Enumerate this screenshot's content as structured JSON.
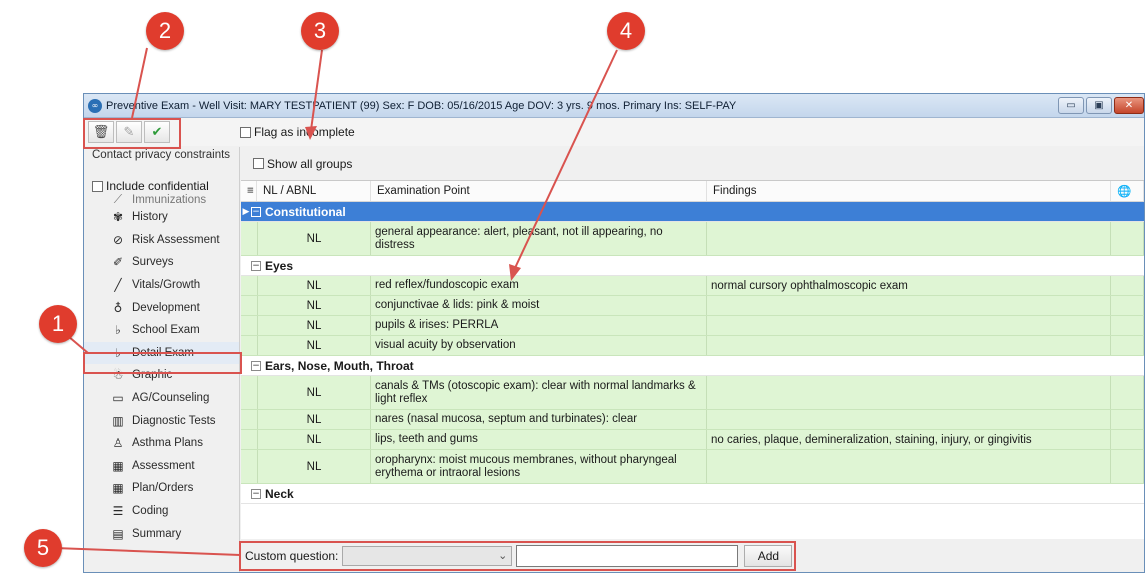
{
  "window": {
    "title": "Preventive Exam - Well Visit:  MARY TESTPATIENT (99)  Sex: F  DOB: 05/16/2015  Age DOV: 3 yrs. 9 mos.  Primary Ins: SELF-PAY",
    "app_icon": "∞",
    "controls": {
      "minimize": "▭",
      "maximize": "▣",
      "close": "✕"
    }
  },
  "toolbar": {
    "delete_icon": "🗑",
    "edit_icon": "✎",
    "complete_icon": "✔",
    "flag_incomplete_label": "Flag as incomplete"
  },
  "sidebar": {
    "privacy_text": "Contact privacy constraints",
    "include_confidential_label": "Include confidential",
    "items": [
      {
        "label": "Immunizations",
        "icon": "syringe-icon",
        "glyph": "⟋"
      },
      {
        "label": "History",
        "icon": "history-icon",
        "glyph": "✾"
      },
      {
        "label": "Risk Assessment",
        "icon": "no-entry-icon",
        "glyph": "⊘"
      },
      {
        "label": "Surveys",
        "icon": "survey-icon",
        "glyph": "✐"
      },
      {
        "label": "Vitals/Growth",
        "icon": "pencil-icon",
        "glyph": "╱"
      },
      {
        "label": "Development",
        "icon": "development-icon",
        "glyph": "♁"
      },
      {
        "label": "School Exam",
        "icon": "stethoscope-icon",
        "glyph": "♭"
      },
      {
        "label": "Detail Exam",
        "icon": "stethoscope-icon",
        "glyph": "♭"
      },
      {
        "label": "Graphic",
        "icon": "body-icon",
        "glyph": "☃"
      },
      {
        "label": "AG/Counseling",
        "icon": "counseling-icon",
        "glyph": "▭"
      },
      {
        "label": "Diagnostic Tests",
        "icon": "test-tubes-icon",
        "glyph": "▥"
      },
      {
        "label": "Asthma Plans",
        "icon": "person-icon",
        "glyph": "♙"
      },
      {
        "label": "Assessment",
        "icon": "table-icon",
        "glyph": "▦"
      },
      {
        "label": "Plan/Orders",
        "icon": "table-icon",
        "glyph": "▦"
      },
      {
        "label": "Coding",
        "icon": "list-icon",
        "glyph": "☰"
      },
      {
        "label": "Summary",
        "icon": "document-icon",
        "glyph": "▤"
      }
    ]
  },
  "main": {
    "show_all_groups_label": "Show all groups",
    "columns": {
      "menu": "≡",
      "nl_abnl": "NL / ABNL",
      "examination_point": "Examination Point",
      "findings": "Findings",
      "globe": "🌐"
    },
    "groups": [
      {
        "name": "Constitutional",
        "rows": [
          {
            "nl": "NL",
            "point": "general appearance: alert, pleasant, not ill appearing, no distress",
            "findings": ""
          }
        ]
      },
      {
        "name": "Eyes",
        "rows": [
          {
            "nl": "NL",
            "point": "red reflex/fundoscopic exam",
            "findings": "normal cursory ophthalmoscopic exam"
          },
          {
            "nl": "NL",
            "point": "conjunctivae & lids: pink & moist",
            "findings": ""
          },
          {
            "nl": "NL",
            "point": "pupils & irises: PERRLA",
            "findings": ""
          },
          {
            "nl": "NL",
            "point": "visual acuity by observation",
            "findings": ""
          }
        ]
      },
      {
        "name": "Ears, Nose, Mouth, Throat",
        "rows": [
          {
            "nl": "NL",
            "point": "canals & TMs (otoscopic exam): clear with normal landmarks & light reflex",
            "findings": ""
          },
          {
            "nl": "NL",
            "point": "nares (nasal mucosa, septum and turbinates): clear",
            "findings": ""
          },
          {
            "nl": "NL",
            "point": "lips, teeth and gums",
            "findings": "no caries, plaque, demineralization, staining, injury, or gingivitis"
          },
          {
            "nl": "NL",
            "point": "oropharynx: moist mucous membranes, without pharyngeal erythema or intraoral lesions",
            "findings": ""
          }
        ]
      },
      {
        "name": "Neck",
        "rows": []
      }
    ],
    "custom_question_label": "Custom question:",
    "custom_question_value": "",
    "add_label": "Add"
  },
  "callouts": [
    "1",
    "2",
    "3",
    "4",
    "5"
  ],
  "colors": {
    "callout": "#e03c2d",
    "normal_row": "#dff5d4",
    "selected_group": "#3d7fd6"
  }
}
